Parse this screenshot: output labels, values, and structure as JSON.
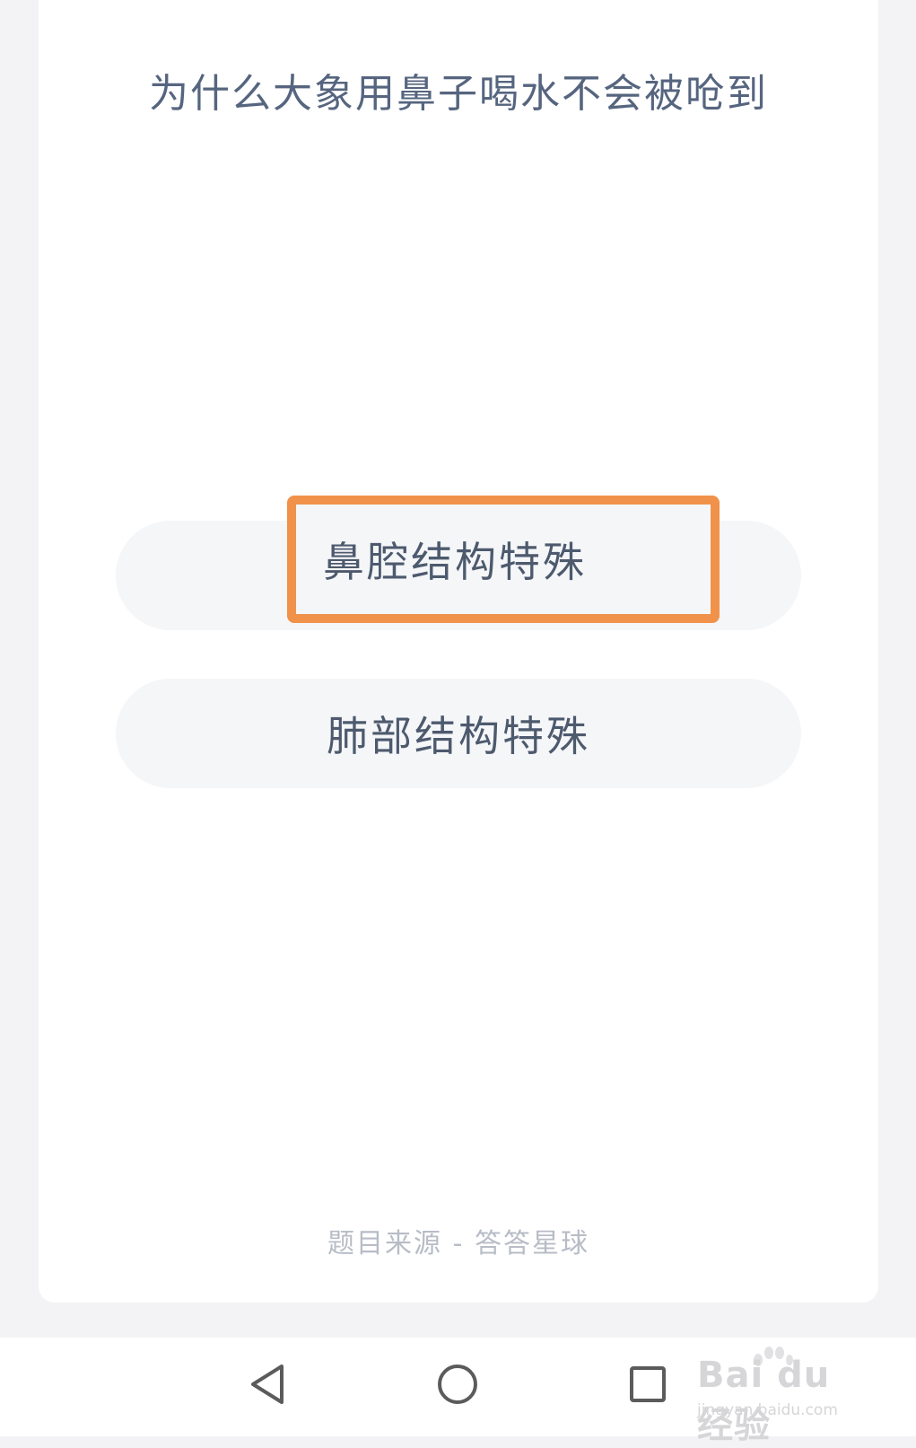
{
  "quiz": {
    "partial_header": "—·—·— ——",
    "question": "为什么大象用鼻子喝水不会被呛到",
    "options": [
      {
        "label": "鼻腔结构特殊",
        "highlighted": true
      },
      {
        "label": "肺部结构特殊",
        "highlighted": false
      }
    ],
    "highlight_color": "#f0924a",
    "source": "题目来源 - 答答星球"
  },
  "navbar": {
    "icons": [
      "back-triangle-icon",
      "home-circle-icon",
      "recent-square-icon"
    ]
  },
  "watermark": {
    "logo": "Bai du 经验",
    "url": "jingyan.baidu.com"
  }
}
